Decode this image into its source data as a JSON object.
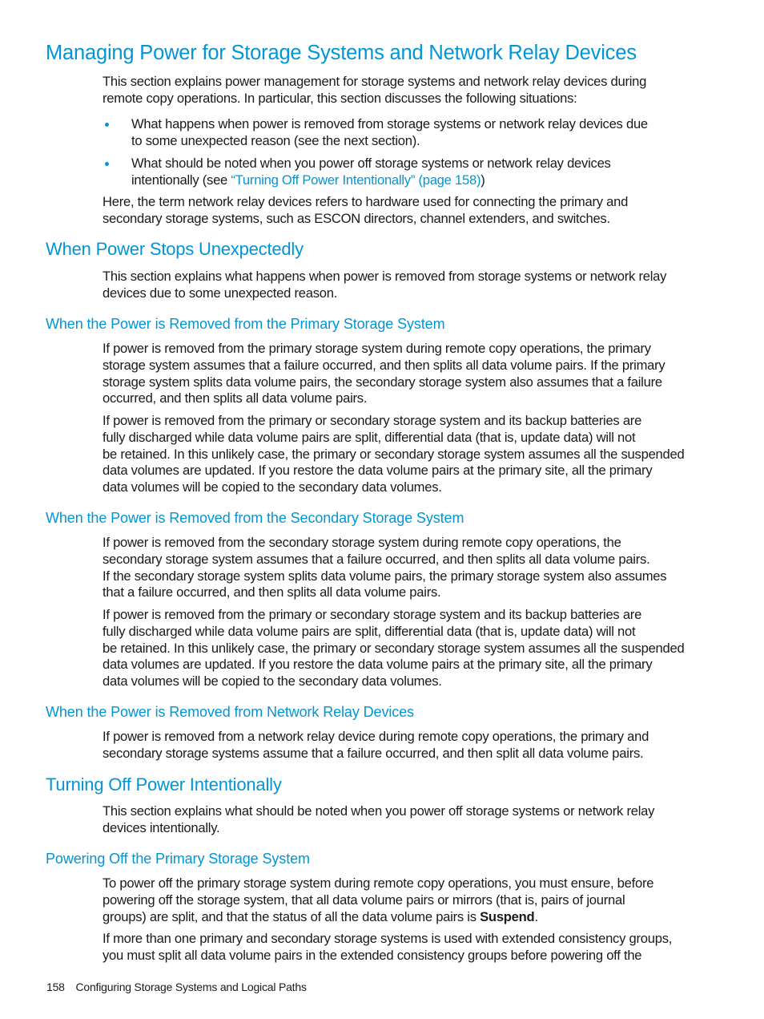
{
  "document": {
    "title": "Managing Power for Storage Systems and Network Relay Devices",
    "intro": {
      "lines": [
        "This section explains power management for storage systems and network relay devices during",
        "remote copy operations. In particular, this section discusses the following situations:"
      ]
    },
    "bullets": [
      {
        "lines": [
          "What happens when power is removed from storage systems or network relay devices due",
          "to some unexpected reason (see the next section)."
        ]
      },
      {
        "line1": "What should be noted when you power off storage systems or network relay devices",
        "line2_prefix": "intentionally (see ",
        "link_text": "“Turning Off Power Intentionally” (page 158)",
        "line2_suffix": ")"
      }
    ],
    "definition": {
      "lines": [
        "Here, the term network relay devices refers to hardware used for connecting the primary and",
        "secondary storage systems, such as ESCON directors, channel extenders, and switches."
      ]
    },
    "sections": [
      {
        "heading": "When Power Stops Unexpectedly",
        "intro_lines": [
          "This section explains what happens when power is removed from storage systems or network relay",
          "devices due to some unexpected reason."
        ]
      },
      {
        "heading": "Turning Off Power Intentionally",
        "intro_lines": [
          "This section explains what should be noted when you power off storage systems or network relay",
          "devices intentionally."
        ]
      }
    ],
    "subsections": [
      {
        "heading": "When the Power is Removed from the Primary Storage System",
        "paragraphs": [
          [
            "If power is removed from the primary storage system during remote copy operations, the primary",
            "storage system assumes that a failure occurred, and then splits all data volume pairs. If the primary",
            "storage system splits data volume pairs, the secondary storage system also assumes that a failure",
            "occurred, and then splits all data volume pairs."
          ],
          [
            "If power is removed from the primary or secondary storage system and its backup batteries are",
            "fully discharged while data volume pairs are split, differential data (that is, update data) will not",
            "be retained. In this unlikely case, the primary or secondary storage system assumes all the suspended",
            "data volumes are updated. If you restore the data volume pairs at the primary site, all the primary",
            "data volumes will be copied to the secondary data volumes."
          ]
        ]
      },
      {
        "heading": "When the Power is Removed from the Secondary Storage System",
        "paragraphs": [
          [
            "If power is removed from the secondary storage system during remote copy operations, the",
            "secondary storage system assumes that a failure occurred, and then splits all data volume pairs.",
            "If the secondary storage system splits data volume pairs, the primary storage system also assumes",
            "that a failure occurred, and then splits all data volume pairs."
          ],
          [
            "If power is removed from the primary or secondary storage system and its backup batteries are",
            "fully discharged while data volume pairs are split, differential data (that is, update data) will not",
            "be retained. In this unlikely case, the primary or secondary storage system assumes all the suspended",
            "data volumes are updated. If you restore the data volume pairs at the primary site, all the primary",
            "data volumes will be copied to the secondary data volumes."
          ]
        ]
      },
      {
        "heading": "When the Power is Removed from Network Relay Devices",
        "paragraphs": [
          [
            "If power is removed from a network relay device during remote copy operations, the primary and",
            "secondary storage systems assume that a failure occurred, and then split all data volume pairs."
          ]
        ]
      },
      {
        "heading": "Powering Off the Primary Storage System",
        "paragraph1_lines": [
          "To power off the primary storage system during remote copy operations, you must ensure, before",
          "powering off the storage system, that all data volume pairs or mirrors (that is, pairs of journal"
        ],
        "paragraph1_last_prefix": "groups) are split, and that the status of all the data volume pairs is ",
        "paragraph1_bold": "Suspend",
        "paragraph1_last_suffix": ".",
        "paragraph2_lines": [
          "If more than one primary and secondary storage systems is used with extended consistency groups,",
          "you must split all data volume pairs in the extended consistency groups before powering off the"
        ]
      }
    ]
  },
  "footer": {
    "page_number": "158",
    "chapter_title": "Configuring Storage Systems and Logical Paths"
  },
  "colors": {
    "heading": "#0096d6",
    "link": "#0096d6",
    "bullet": "#0096d6",
    "body_text": "#1a1a1a"
  }
}
